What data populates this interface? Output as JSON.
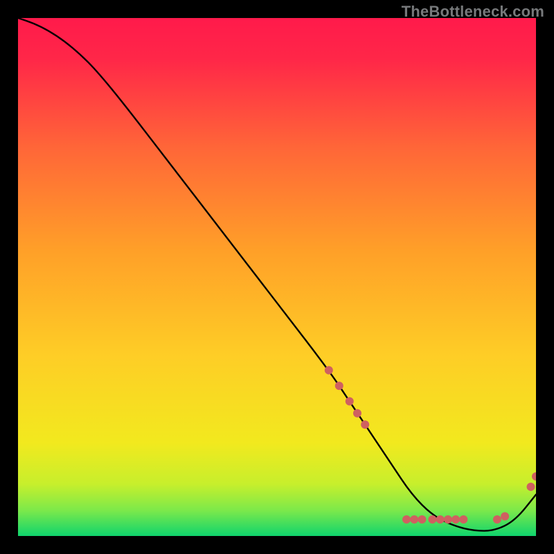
{
  "watermark": "TheBottleneck.com",
  "chart_data": {
    "type": "line",
    "title": "",
    "xlabel": "",
    "ylabel": "",
    "xlim": [
      0,
      100
    ],
    "ylim": [
      0,
      100
    ],
    "grid": false,
    "legend": "none",
    "background_gradient": {
      "top": "#ff1a4b",
      "mid": "#fecd26",
      "bottom": "#0fd46d"
    },
    "series": [
      {
        "name": "bottleneck-curve",
        "color": "#000000",
        "x": [
          0,
          3,
          6,
          9,
          12,
          15,
          20,
          30,
          40,
          50,
          60,
          64,
          68,
          72,
          76,
          80,
          84,
          88,
          92,
          96,
          100
        ],
        "y": [
          100,
          99,
          97.5,
          95.5,
          93,
          90,
          84,
          71,
          58,
          45,
          32,
          26,
          20,
          14,
          8,
          4,
          2,
          1,
          1,
          3,
          8
        ]
      }
    ],
    "markers": {
      "name": "highlighted-points",
      "color": "#cf6060",
      "radius": 6,
      "points": [
        {
          "x": 60,
          "y": 32
        },
        {
          "x": 62,
          "y": 29
        },
        {
          "x": 64,
          "y": 26
        },
        {
          "x": 65.5,
          "y": 23.7
        },
        {
          "x": 67,
          "y": 21.5
        },
        {
          "x": 75,
          "y": 3.2
        },
        {
          "x": 76.5,
          "y": 3.2
        },
        {
          "x": 78,
          "y": 3.2
        },
        {
          "x": 80,
          "y": 3.2
        },
        {
          "x": 81.5,
          "y": 3.2
        },
        {
          "x": 83,
          "y": 3.2
        },
        {
          "x": 84.5,
          "y": 3.2
        },
        {
          "x": 86,
          "y": 3.2
        },
        {
          "x": 92.5,
          "y": 3.2
        },
        {
          "x": 94,
          "y": 3.8
        },
        {
          "x": 99,
          "y": 9.5
        },
        {
          "x": 100,
          "y": 11.5
        }
      ]
    }
  }
}
